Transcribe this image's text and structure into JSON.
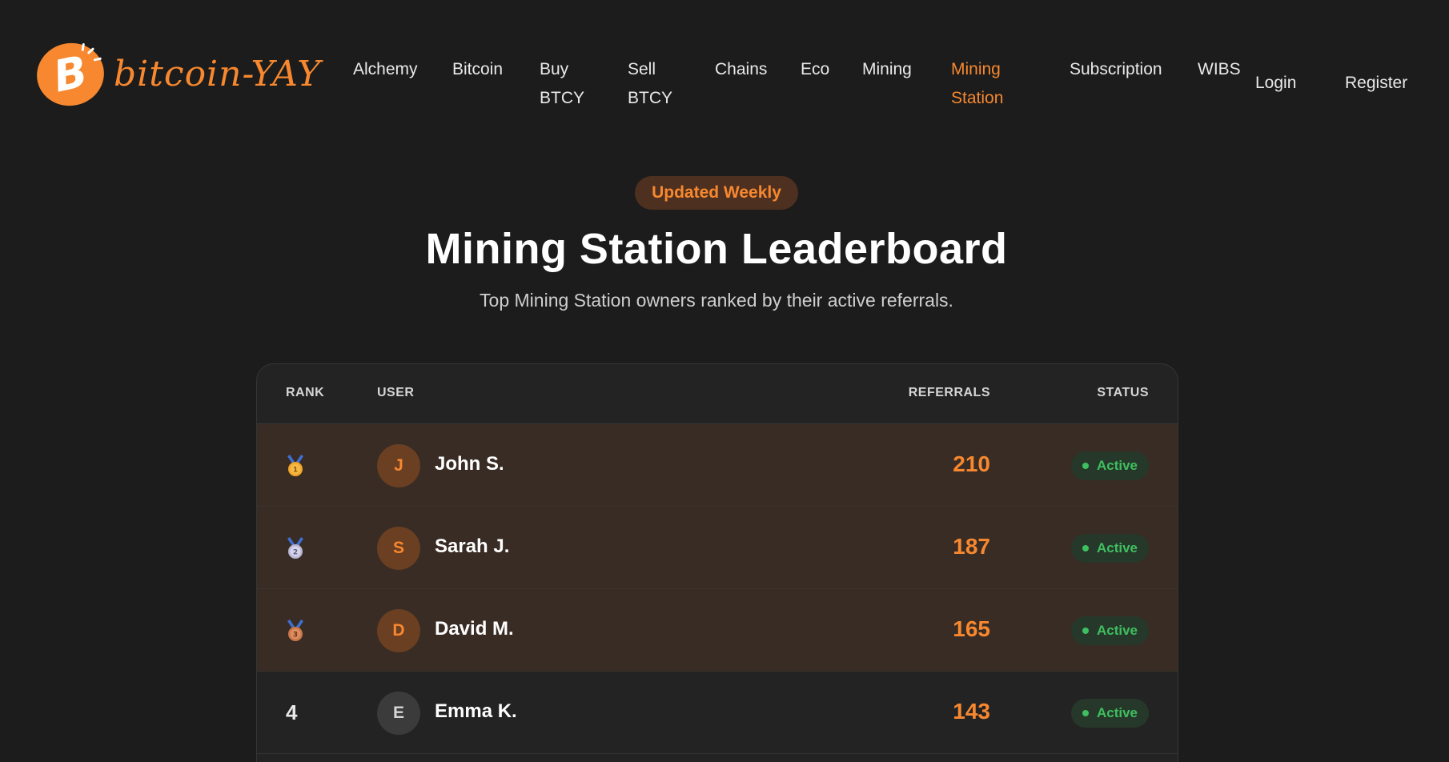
{
  "brand": {
    "name": "bitcoin-YAY",
    "logo_icon": "bitcoin-sun-logo-icon",
    "accent_color": "#f7882f"
  },
  "nav": {
    "items": [
      {
        "label": "Alchemy",
        "active": false
      },
      {
        "label": "Bitcoin",
        "active": false
      },
      {
        "label_line1": "Buy",
        "label_line2": "BTCY",
        "active": false
      },
      {
        "label_line1": "Sell",
        "label_line2": "BTCY",
        "active": false
      },
      {
        "label": "Chains",
        "active": false
      },
      {
        "label": "Eco",
        "active": false
      },
      {
        "label": "Mining",
        "active": false
      },
      {
        "label_line1": "Mining",
        "label_line2": "Station",
        "active": true
      },
      {
        "label": "Subscription",
        "active": false
      },
      {
        "label": "WIBS",
        "active": false
      }
    ],
    "login": "Login",
    "register": "Register"
  },
  "hero": {
    "badge": "Updated Weekly",
    "title": "Mining Station Leaderboard",
    "subtitle": "Top Mining Station owners ranked by their active referrals."
  },
  "table": {
    "headers": {
      "rank": "RANK",
      "user": "USER",
      "referrals": "REFERRALS",
      "status": "STATUS"
    },
    "rows": [
      {
        "rank": "1",
        "medal": "gold-medal-icon",
        "initial": "J",
        "name": "John S.",
        "referrals": "210",
        "status": "Active"
      },
      {
        "rank": "2",
        "medal": "silver-medal-icon",
        "initial": "S",
        "name": "Sarah J.",
        "referrals": "187",
        "status": "Active"
      },
      {
        "rank": "3",
        "medal": "bronze-medal-icon",
        "initial": "D",
        "name": "David M.",
        "referrals": "165",
        "status": "Active"
      },
      {
        "rank": "4",
        "medal": null,
        "initial": "E",
        "name": "Emma K.",
        "referrals": "143",
        "status": "Active"
      }
    ]
  }
}
